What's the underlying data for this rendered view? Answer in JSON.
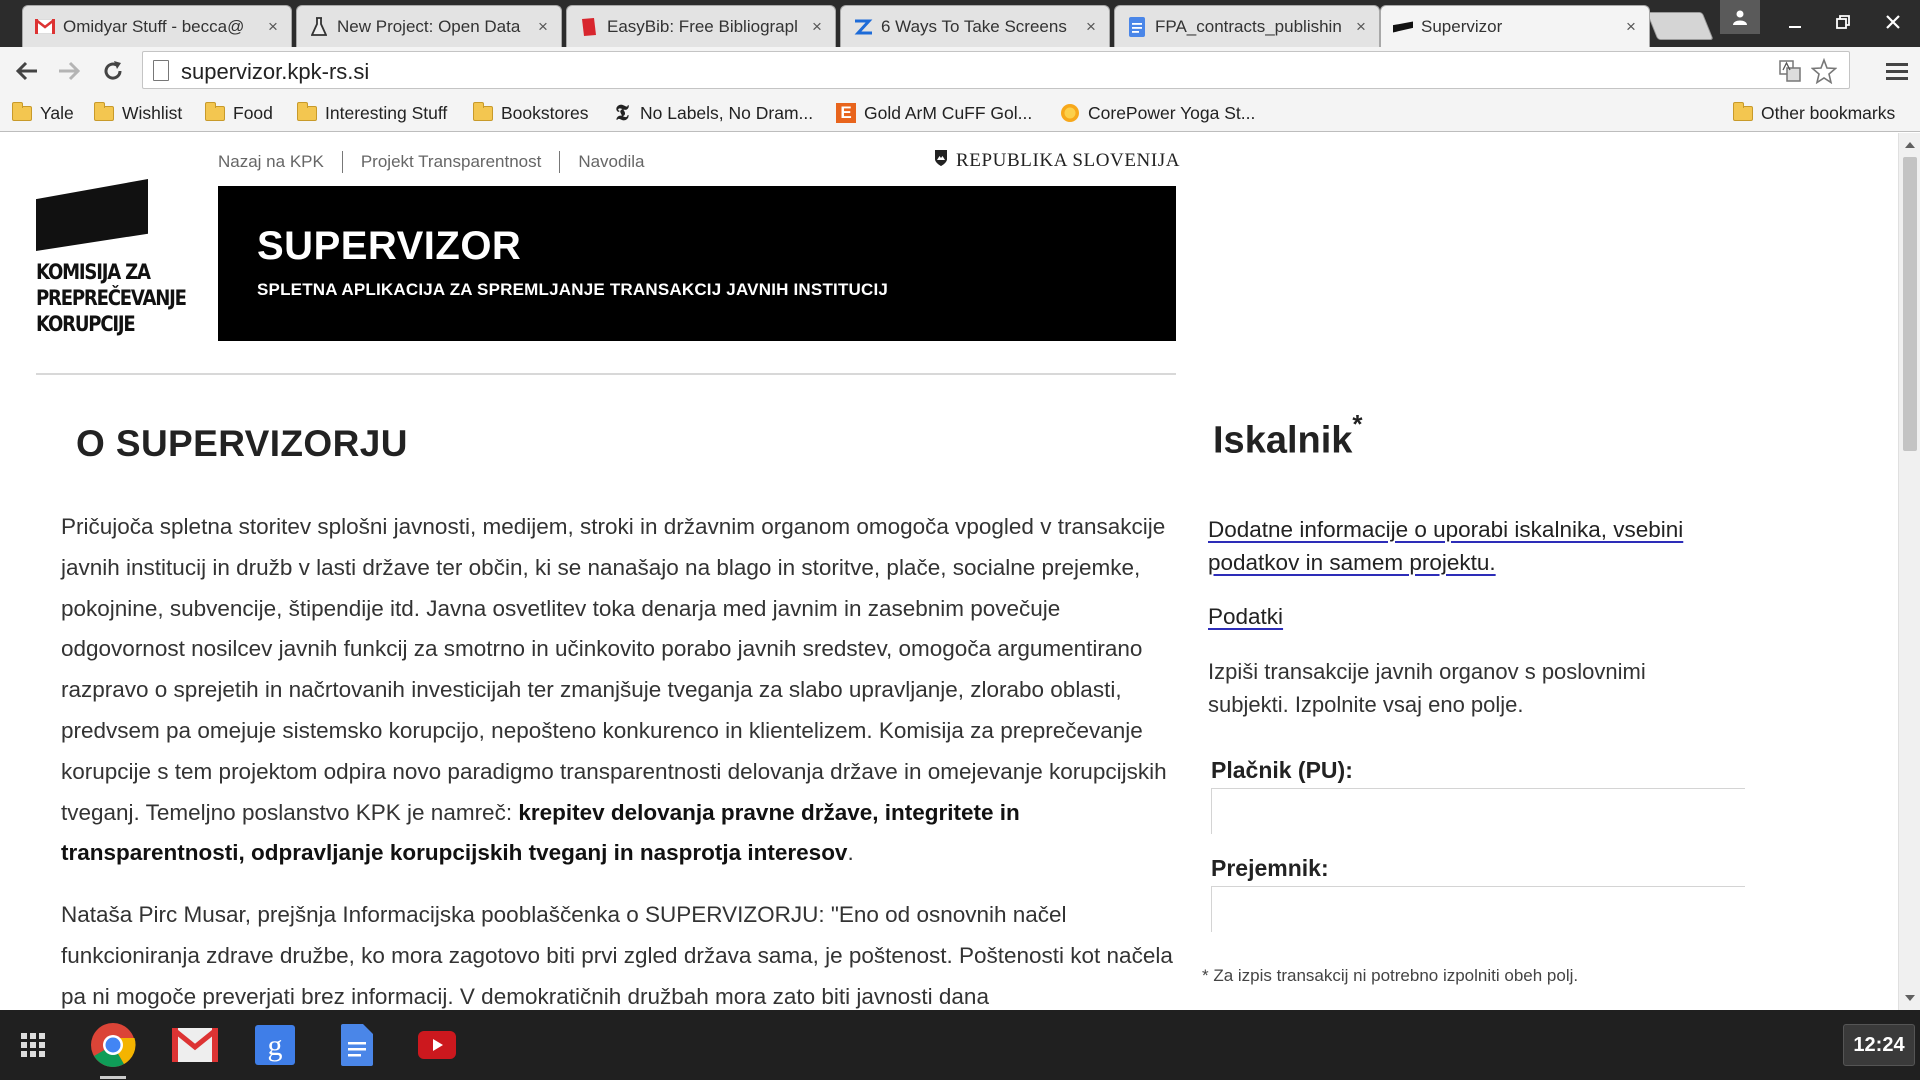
{
  "browser": {
    "tabs": [
      {
        "title": "Omidyar Stuff - becca@",
        "icon": "gmail-icon"
      },
      {
        "title": "New Project: Open Data",
        "icon": "flask-icon"
      },
      {
        "title": "EasyBib: Free Bibliograpl",
        "icon": "easybib-icon"
      },
      {
        "title": "6 Ways To Take Screens",
        "icon": "zapier-icon"
      },
      {
        "title": "FPA_contracts_publishin",
        "icon": "docs-icon"
      },
      {
        "title": "Supervizor",
        "icon": "kpk-icon",
        "active": true
      }
    ],
    "close_glyph": "×",
    "url": "supervizor.kpk-rs.si",
    "bookmarks": [
      {
        "label": "Yale",
        "icon": "folder-icon"
      },
      {
        "label": "Wishlist",
        "icon": "folder-icon"
      },
      {
        "label": "Food",
        "icon": "folder-icon"
      },
      {
        "label": "Interesting Stuff",
        "icon": "folder-icon"
      },
      {
        "label": "Bookstores",
        "icon": "folder-icon"
      },
      {
        "label": "No Labels, No Dram...",
        "icon": "nyt-icon"
      },
      {
        "label": "Gold ArM CuFF Gol...",
        "icon": "etsy-icon"
      },
      {
        "label": "CorePower Yoga St...",
        "icon": "sun-icon"
      },
      {
        "label": "Other bookmarks",
        "icon": "folder-icon"
      }
    ]
  },
  "page": {
    "logo_text": [
      "KOMISIJA ZA",
      "PREPREČEVANJE",
      "KORUPCIJE"
    ],
    "topnav": [
      "Nazaj na KPK",
      "Projekt Transparentnost",
      "Navodila"
    ],
    "republika": "REPUBLIKA SLOVENIJA",
    "banner_title": "SUPERVIZOR",
    "banner_subtitle": "SPLETNA APLIKACIJA ZA SPREMLJANJE TRANSAKCIJ JAVNIH INSTITUCIJ",
    "main_heading": "O SUPERVIZORJU",
    "para1_text": "Pričujoča spletna storitev splošni javnosti, medijem, stroki in državnim organom omogoča vpogled v transakcije javnih institucij in družb v lasti države ter občin, ki se nanašajo na blago in storitve, plače, socialne prejemke, pokojnine, subvencije, štipendije itd. Javna osvetlitev toka denarja med javnim in zasebnim povečuje odgovornost nosilcev javnih funkcij za smotrno in učinkovito porabo javnih sredstev, omogoča argumentirano razpravo o sprejetih in načrtovanih investicijah ter zmanjšuje tveganja za slabo upravljanje, zlorabo oblasti, predvsem pa omejuje sistemsko korupcijo, nepošteno konkurenco in klientelizem. Komisija za preprečevanje korupcije s tem projektom odpira novo paradigmo transparentnosti delovanja države in omejevanje korupcijskih tveganj. Temeljno poslanstvo KPK je namreč: ",
    "para1_bold": "krepitev delovanja pravne države, integritete in transparentnosti, odpravljanje korupcijskih tveganj in nasprotja interesov",
    "para1_end": ".",
    "para2_text": "Nataša Pirc Musar, prejšnja Informacijska pooblaščenka o SUPERVIZORJU: \"Eno od osnovnih načel funkcioniranja zdrave družbe, ko mora zagotovo biti prvi zgled država sama, je poštenost. Poštenosti kot načela pa ni mogoče preverjati brez informacij. V demokratičnih družbah mora zato biti javnosti dana",
    "sidebar": {
      "heading": "Iskalnik",
      "heading_sup": "*",
      "info_link": "Dodatne informacije o uporabi iskalnika, vsebini podatkov in samem projektu.",
      "data_link": "Podatki",
      "description": "Izpiši transakcije javnih organov s poslovnimi subjekti. Izpolnite vsaj eno polje.",
      "payer_label": "Plačnik (PU):",
      "payer_value": "",
      "recipient_label": "Prejemnik:",
      "recipient_value": "",
      "footnote": "* Za izpis transakcij ni potrebno izpolniti obeh polj."
    }
  },
  "shelf": {
    "apps": [
      "launcher-icon",
      "chrome-icon",
      "gmail-icon",
      "google-search-icon",
      "docs-icon",
      "youtube-icon"
    ],
    "clock": "12:24"
  }
}
